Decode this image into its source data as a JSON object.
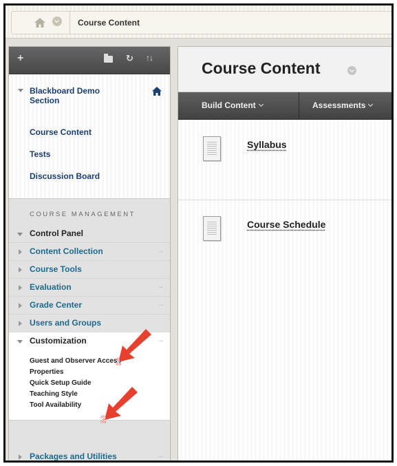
{
  "breadcrumb": {
    "current": "Course Content",
    "icons": {
      "home": "home-icon",
      "menu": "chevron-down-icon"
    }
  },
  "menu": {
    "toolbar": {
      "add": "+",
      "icons": [
        "plus-icon",
        "folder-icon",
        "refresh-icon",
        "sort-icon"
      ],
      "refresh": "↻",
      "sort": "↑↓"
    },
    "course_title": "Blackboard Demo Section",
    "course_links": [
      "Course Content",
      "Tests",
      "Discussion Board"
    ],
    "management_header": "COURSE MANAGEMENT",
    "control_panel": "Control Panel",
    "panel_items": [
      "Content Collection",
      "Course Tools",
      "Evaluation",
      "Grade Center",
      "Users and Groups"
    ],
    "customization": {
      "label": "Customization",
      "sub_items": [
        "Guest and Observer Access",
        "Properties",
        "Quick Setup Guide",
        "Teaching Style",
        "Tool Availability"
      ]
    },
    "packages": "Packages and Utilities",
    "row_arrow": "→"
  },
  "content": {
    "title": "Course Content",
    "actions": [
      {
        "label": "Build Content"
      },
      {
        "label": "Assessments"
      }
    ],
    "items": [
      {
        "title": "Syllabus",
        "icon": "document-icon"
      },
      {
        "title": "Course Schedule",
        "icon": "document-icon"
      }
    ]
  },
  "annotations": {
    "callout_1": "1",
    "callout_2": "2",
    "color": "#e8402f"
  }
}
